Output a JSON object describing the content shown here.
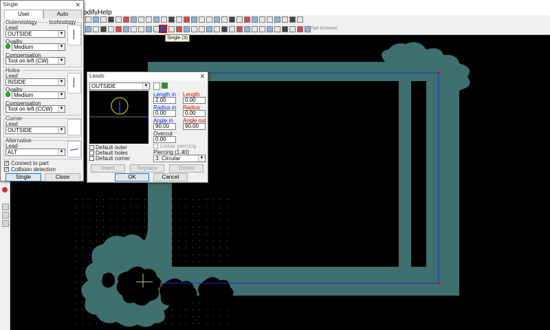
{
  "menu": {
    "modify": "odify",
    "help": "Help"
  },
  "toolbar": {
    "tooltip": "Single (3)",
    "part_browser": "Part browser"
  },
  "single_dialog": {
    "title": "Single",
    "tabs": [
      "User technology",
      "Auto technology"
    ],
    "outer": {
      "group": "Outer",
      "lead_label": "Lead",
      "lead_value": "OUTSIDE",
      "quality_label": "Quality",
      "quality_value": "Medium",
      "comp_label": "Compensation",
      "comp_value": "Tool on left (CW)"
    },
    "holes": {
      "group": "Holes",
      "lead_label": "Lead",
      "lead_value": "INSIDE",
      "quality_label": "Quality",
      "quality_value": "Medium",
      "comp_label": "Compensation",
      "comp_value": "Tool on left (CCW)"
    },
    "corner": {
      "group": "Corner",
      "lead_label": "Lead",
      "lead_value": "OUTSIDE"
    },
    "alternative": {
      "group": "Alternative",
      "lead_label": "Lead",
      "lead_value": "ALT"
    },
    "connect_to_part": "Connect to part",
    "collision_detection": "Collision detection",
    "single_button": "Single",
    "close_button": "Close"
  },
  "leads_dialog": {
    "title": "Leads",
    "lead_select": "OUTSIDE",
    "length_in_label": "Length in",
    "length_in": "2.00",
    "length_out_label": "Length out",
    "length_out": "0.00",
    "radius_in_label": "Radius in",
    "radius_in": "0.00",
    "radius_out_label": "Radius out",
    "radius_out": "0.00",
    "angle_in_label": "Angle in",
    "angle_in": "90.00",
    "angle_out_label": "Angle out",
    "angle_out": "90.00",
    "overcut_label": "Overcut",
    "overcut": "0.00",
    "linear_piercing": "Linear piercing",
    "piercing_label": "Piercing (1.40)",
    "piercing_value": "3: Circular",
    "default_outer": "Default outer",
    "default_holes": "Default holes",
    "default_corner": "Default corner",
    "insert": "Insert",
    "replace": "Replace",
    "delete": "Delete",
    "ok": "OK",
    "cancel": "Cancel"
  },
  "colors": {
    "part_fill": "#3f6f6f",
    "path_blue": "#1f2fd0",
    "highlight_red": "#e00000"
  }
}
